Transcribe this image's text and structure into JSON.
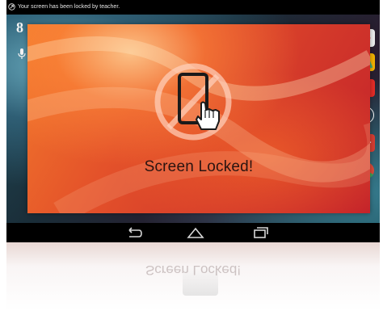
{
  "status_bar": {
    "message": "Your screen has been locked by teacher.",
    "badge_icon": "lock-badge-icon"
  },
  "left_rail": {
    "google_icon_label": "8",
    "mic_icon": "microphone-icon"
  },
  "lock_overlay": {
    "title": "Screen Locked!",
    "graphic_icon": "tablet-prohibited-icon",
    "hand_icon": "hand-pointer-icon"
  },
  "right_dock": {
    "items": [
      {
        "name": "play-store-icon",
        "color": "#e8e8e8"
      },
      {
        "name": "maps-icon",
        "color": "#f4b400"
      },
      {
        "name": "youtube-icon",
        "color": "#e52d27"
      },
      {
        "name": "apps-drawer-icon",
        "color": "#ffffff"
      },
      {
        "name": "google-plus-icon",
        "label": "g+",
        "color": "#d73d32"
      },
      {
        "name": "chrome-icon",
        "color": "#dd4b39"
      }
    ]
  },
  "nav_bar": {
    "back_icon": "back-icon",
    "home_icon": "home-icon",
    "recents_icon": "recents-icon"
  },
  "reflection": {
    "text": "Screen Locked!"
  }
}
